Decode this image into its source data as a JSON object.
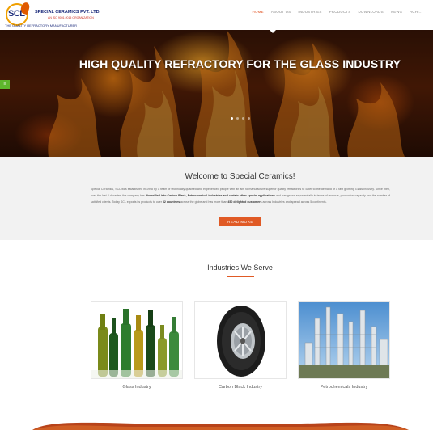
{
  "brand": {
    "logo_letters": "SCL",
    "logo_tagline": "THE QUALITY REFRACTORY MANUFACTURER",
    "company_name": "SPECIAL CERAMICS PVT. LTD.",
    "iso": "AN ISO 9001:2015 ORGANIZATION"
  },
  "nav": {
    "items": [
      "HOME",
      "ABOUT US",
      "INDUSTRIES",
      "PRODUCTS",
      "DOWNLOADS",
      "NEWS",
      "ACHI..."
    ],
    "active_index": 0,
    "active_color": "#e25a2b"
  },
  "hero": {
    "title": "HIGH QUALITY REFRACTORY FOR THE GLASS INDUSTRY",
    "slides": 4,
    "active_slide": 0,
    "side_tab_icon": "menu-icon"
  },
  "welcome": {
    "title": "Welcome to Special Ceramics!",
    "body_parts": [
      {
        "text": "Special Ceramics, SCL was established in 1998 by a team of technically qualified and experienced people with an aim to manufacture superior quality refractories to cater to the demand of a fast growing Glass Industry. Since then, over the last 3 decades, the company has ",
        "bold": false
      },
      {
        "text": "diversified into Carbon Black, Petrochemical industries and certain other special applications",
        "bold": true
      },
      {
        "text": " and has grown exponentially in terms of revenue, production capacity and the number of satisfied clients. Today SCL exports its products to over ",
        "bold": false
      },
      {
        "text": "32 countries",
        "bold": true
      },
      {
        "text": " across the globe and has more than ",
        "bold": false
      },
      {
        "text": "450 delighted customers",
        "bold": true
      },
      {
        "text": " across Industries and spread across 5 continents.",
        "bold": false
      }
    ],
    "button": "READ MORE",
    "accent": "#e05a25"
  },
  "industries": {
    "title": "Industries We Serve",
    "items": [
      {
        "label": "Glass Industry",
        "image": "glass-bottles-image"
      },
      {
        "label": "Carbon Black Industry",
        "image": "tyre-image"
      },
      {
        "label": "Petrochemicals Industry",
        "image": "refinery-image"
      }
    ]
  }
}
